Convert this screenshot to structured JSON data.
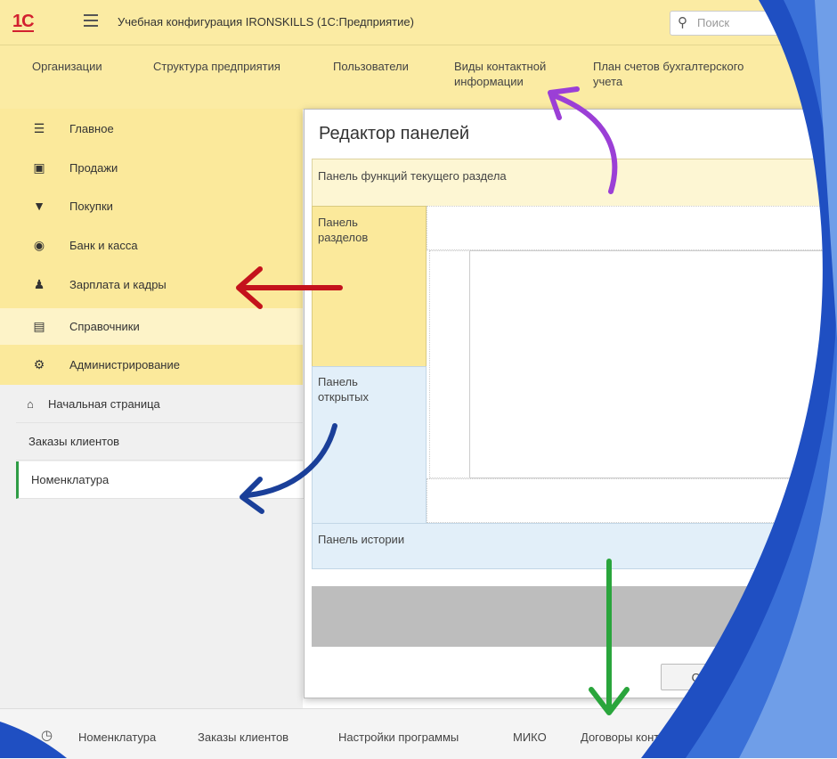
{
  "app": {
    "logo": "1С",
    "title": "Учебная конфигурация IRONSKILLS  (1С:Предприятие)",
    "search_placeholder": "Поиск"
  },
  "function_panel": {
    "items": [
      {
        "label": "Организации"
      },
      {
        "label": "Структура предприятия"
      },
      {
        "label": "Пользователи"
      },
      {
        "label": "Виды контактной\nинформации"
      },
      {
        "label": "План счетов бухгалтерского\nучета"
      }
    ]
  },
  "sections": {
    "items": [
      {
        "label": "Главное",
        "icon": "list-icon"
      },
      {
        "label": "Продажи",
        "icon": "bag-icon"
      },
      {
        "label": "Покупки",
        "icon": "cart-icon"
      },
      {
        "label": "Банк и касса",
        "icon": "coin-icon"
      },
      {
        "label": "Зарплата и кадры",
        "icon": "person-icon"
      },
      {
        "label": "Справочники",
        "icon": "book-icon",
        "active": true
      },
      {
        "label": "Администрирование",
        "icon": "gear-icon"
      }
    ]
  },
  "open_panel": {
    "items": [
      {
        "label": "Начальная страница",
        "icon": "home-icon"
      },
      {
        "label": "Заказы клиентов"
      },
      {
        "label": "Номенклатура",
        "current": true
      }
    ]
  },
  "dialog": {
    "title": "Редактор панелей",
    "panel_function": "Панель функций текущего раздела",
    "panel_sections": "Панель\nразделов",
    "panel_open": "Панель\nоткрытых",
    "panel_history": "Панель истории",
    "ok_label": "OK"
  },
  "history_bar": {
    "items": [
      {
        "label": "Номенклатура"
      },
      {
        "label": "Заказы клиентов"
      },
      {
        "label": "Настройки программы"
      },
      {
        "label": "МИКО"
      },
      {
        "label": "Договоры контрагентов"
      }
    ]
  },
  "colors": {
    "accent_yellow": "#fbe99b",
    "accent_blue": "#e2eff9",
    "arrow_purple": "#9b3fd6",
    "arrow_red": "#c4121c",
    "arrow_blue": "#1a3f99",
    "arrow_green": "#2aa53c"
  }
}
